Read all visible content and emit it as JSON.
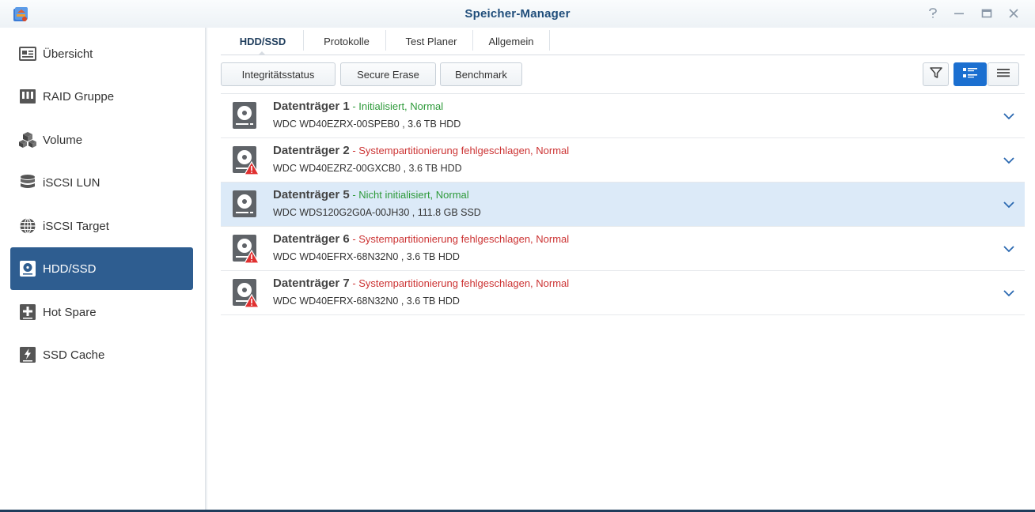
{
  "window": {
    "title": "Speicher-Manager",
    "controls": [
      "help-icon",
      "minimize-icon",
      "maximize-icon",
      "close-icon"
    ]
  },
  "sidebar": {
    "items": [
      {
        "label": "Übersicht",
        "icon": "overview-icon",
        "active": false
      },
      {
        "label": "RAID Gruppe",
        "icon": "raid-icon",
        "active": false
      },
      {
        "label": "Volume",
        "icon": "volume-icon",
        "active": false
      },
      {
        "label": "iSCSI LUN",
        "icon": "database-icon",
        "active": false
      },
      {
        "label": "iSCSI Target",
        "icon": "globe-icon",
        "active": false
      },
      {
        "label": "HDD/SSD",
        "icon": "hdd-icon",
        "active": true
      },
      {
        "label": "Hot Spare",
        "icon": "hot-spare-icon",
        "active": false
      },
      {
        "label": "SSD Cache",
        "icon": "ssd-cache-icon",
        "active": false
      }
    ]
  },
  "tabs": [
    {
      "label": "HDD/SSD",
      "active": true
    },
    {
      "label": "Protokolle",
      "active": false
    },
    {
      "label": "Test Planer",
      "active": false
    },
    {
      "label": "Allgemein",
      "active": false
    }
  ],
  "toolbar": {
    "integrity_label": "Integritätsstatus",
    "secure_erase_label": "Secure Erase",
    "benchmark_label": "Benchmark",
    "view_mode": "detail-list"
  },
  "disks": [
    {
      "name": "Datenträger 1",
      "status": " - Initialisiert, Normal",
      "status_type": "ok",
      "model": "WDC WD40EZRX-00SPEB0 , 3.6 TB HDD",
      "warning": false,
      "selected": false
    },
    {
      "name": "Datenträger 2",
      "status": " - Systempartitionierung fehlgeschlagen, Normal",
      "status_type": "err",
      "model": "WDC WD40EZRZ-00GXCB0 , 3.6 TB HDD",
      "warning": true,
      "selected": false
    },
    {
      "name": "Datenträger 5",
      "status": " - Nicht initialisiert, Normal",
      "status_type": "ok",
      "model": "WDC WDS120G2G0A-00JH30 , 111.8 GB SSD",
      "warning": false,
      "selected": true
    },
    {
      "name": "Datenträger 6",
      "status": " - Systempartitionierung fehlgeschlagen, Normal",
      "status_type": "err",
      "model": "WDC WD40EFRX-68N32N0 , 3.6 TB HDD",
      "warning": true,
      "selected": false
    },
    {
      "name": "Datenträger 7",
      "status": " - Systempartitionierung fehlgeschlagen, Normal",
      "status_type": "err",
      "model": "WDC WD40EFRX-68N32N0 , 3.6 TB HDD",
      "warning": true,
      "selected": false
    }
  ],
  "colors": {
    "accent": "#2e5d90",
    "title": "#1f4d7a",
    "ok": "#2e9a3a",
    "error": "#cc3333",
    "selected_row": "#dceaf8",
    "view_toggle_on": "#1b6fd0"
  }
}
